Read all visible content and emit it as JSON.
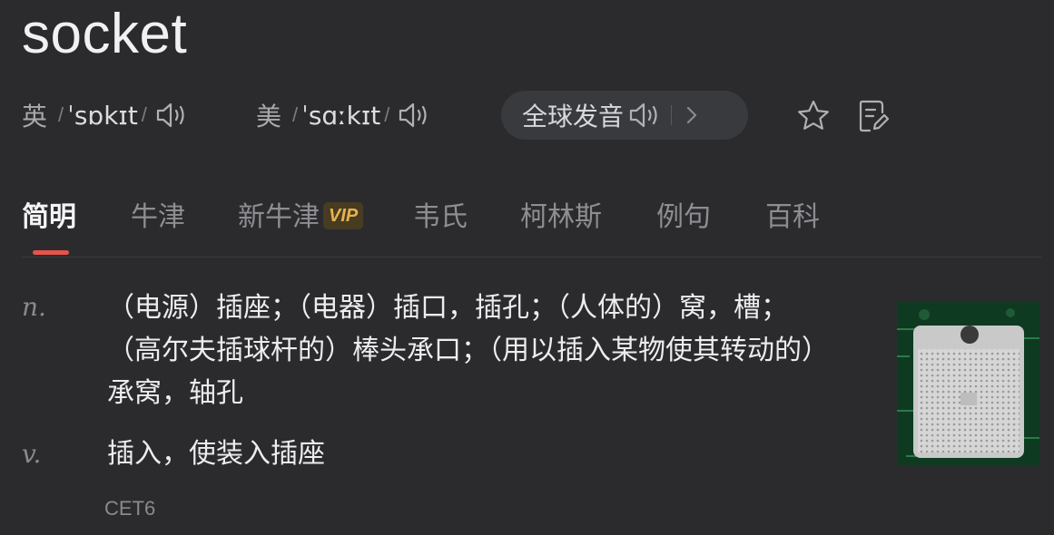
{
  "word": "socket",
  "pronunciations": [
    {
      "region": "英",
      "ipa": "ˈsɒkɪt"
    },
    {
      "region": "美",
      "ipa": "ˈsɑːkɪt"
    }
  ],
  "global_pronunciation": {
    "label": "全球发音"
  },
  "tabs": [
    {
      "label": "简明",
      "active": true
    },
    {
      "label": "牛津"
    },
    {
      "label": "新牛津",
      "badge": "VIP"
    },
    {
      "label": "韦氏"
    },
    {
      "label": "柯林斯"
    },
    {
      "label": "例句"
    },
    {
      "label": "百科"
    }
  ],
  "definitions": [
    {
      "pos": "n.",
      "text": "（电源）插座；（电器）插口，插孔；（人体的）窝，槽；（高尔夫插球杆的）棒头承口；（用以插入某物使其转动的）承窝，轴孔"
    },
    {
      "pos": "v.",
      "text": "插入，使装入插座"
    }
  ],
  "exam_tag": "CET6",
  "colors": {
    "background": "#2b2b2e",
    "accent": "#e5534b",
    "vip_text": "#e7b24b",
    "pill_bg": "#393a3e"
  },
  "icons": {
    "speaker": "speaker-icon",
    "chevron": "chevron-right-icon",
    "favorite": "star-icon",
    "notes": "note-edit-icon"
  }
}
